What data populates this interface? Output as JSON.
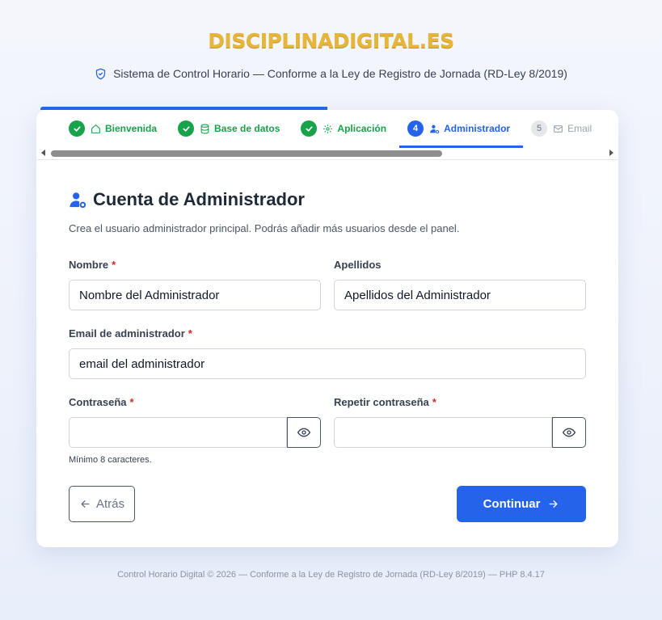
{
  "brand": {
    "logo_text": "DISCIPLINADIGITAL.ES",
    "logo_color": "#e5b63a"
  },
  "header": {
    "subtitle": "Sistema de Control Horario — Conforme a la Ley de Registro de Jornada (RD-Ley 8/2019)",
    "subtitle_icon": "shield-check-icon"
  },
  "wizard": {
    "progress_percent": 50,
    "steps": [
      {
        "number": "1",
        "label": "Bienvenida",
        "icon": "home-icon",
        "state": "done"
      },
      {
        "number": "2",
        "label": "Base de datos",
        "icon": "database-icon",
        "state": "done"
      },
      {
        "number": "3",
        "label": "Aplicación",
        "icon": "gear-icon",
        "state": "done"
      },
      {
        "number": "4",
        "label": "Administrador",
        "icon": "user-gear-icon",
        "state": "active"
      },
      {
        "number": "5",
        "label": "Email",
        "icon": "envelope-icon",
        "state": "pending"
      }
    ]
  },
  "form": {
    "title": "Cuenta de Administrador",
    "description": "Crea el usuario administrador principal. Podrás añadir más usuarios desde el panel.",
    "required_mark": "*",
    "first_name": {
      "label": "Nombre",
      "placeholder": "Nombre del Administrador",
      "value": ""
    },
    "last_name": {
      "label": "Apellidos",
      "placeholder": "Apellidos del Administrador",
      "value": ""
    },
    "email": {
      "label": "Email de administrador",
      "placeholder": "email del administrador",
      "value": ""
    },
    "password": {
      "label": "Contraseña",
      "value": "",
      "hint": "Mínimo 8 caracteres."
    },
    "password_confirm": {
      "label": "Repetir contraseña",
      "value": ""
    }
  },
  "actions": {
    "back_label": "Atrás",
    "continue_label": "Continuar"
  },
  "colors": {
    "primary": "#2563eb",
    "success": "#16a34a",
    "required": "#dc2626"
  },
  "footer": {
    "text": "Control Horario Digital © 2026 — Conforme a la Ley de Registro de Jornada (RD-Ley 8/2019) — PHP 8.4.17"
  }
}
